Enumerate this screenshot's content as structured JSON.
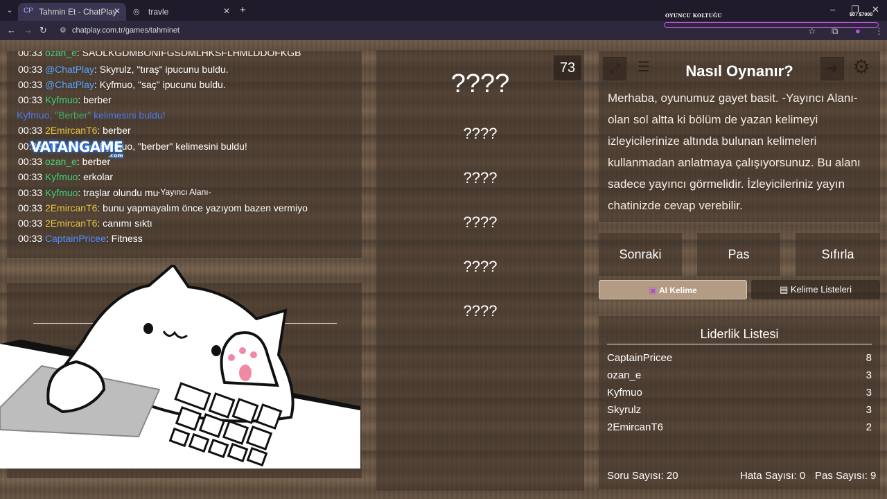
{
  "browser": {
    "tabs": [
      {
        "label": "Tahmin Et - ChatPlay",
        "favicon": "CP"
      },
      {
        "label": "travle"
      }
    ],
    "url": "chatplay.com.tr/games/tahminet"
  },
  "overlay": {
    "title": "OYUNCU KOLTUĞU",
    "money": "$0 / $7000",
    "accent": "#c050e0"
  },
  "chat": {
    "lines": [
      {
        "time": "00:33",
        "user": "ozan_e",
        "msg": ": SAOLKGDMBONIFGSDMLHKSFLHMLDDOFKGB",
        "color": "green"
      },
      {
        "time": "00:33",
        "user": "@ChatPlay",
        "msg": ": Skyrulz, \"tıraş\" ipucunu buldu.",
        "color": "blue"
      },
      {
        "time": "00:33",
        "user": "@ChatPlay",
        "msg": ": Kyfmuo, \"saç\" ipucunu buldu.",
        "color": "blue"
      },
      {
        "time": "00:33",
        "user": "Kyfmuo",
        "msg": ": berber",
        "color": "green"
      },
      {
        "time": "",
        "user": "Kyfmuo, ",
        "msg": " kelimesini buldu!",
        "word": "\"Berber\"",
        "color": "sys"
      },
      {
        "time": "00:33",
        "user": "2EmircanT6",
        "msg": ": berber",
        "color": "yellow"
      },
      {
        "time": "00:33",
        "user": "@ChatPlay",
        "msg": ": Kyfmuo, \"berber\" kelimesini buldu!",
        "color": "blue"
      },
      {
        "time": "00:33",
        "user": "ozan_e",
        "msg": ": berber",
        "color": "green"
      },
      {
        "time": "00:33",
        "user": "Kyfmuo",
        "msg": ": erkolar",
        "color": "green"
      },
      {
        "time": "00:33",
        "user": "Kyfmuo",
        "msg": ": traşlar olundu mu",
        "color": "green"
      },
      {
        "time": "00:33",
        "user": "2EmircanT6",
        "msg": ": bunu yapmayalım önce yazıyom bazen vermiyo",
        "color": "yellow"
      },
      {
        "time": "00:33",
        "user": "2EmircanT6",
        "msg": ": canımı sıktı",
        "color": "yellow"
      },
      {
        "time": "00:33",
        "user": "CaptainPricee",
        "msg": ": Fitness",
        "color": "cpt"
      }
    ]
  },
  "watermark": {
    "text": "VATANGAME",
    "sub": ".com"
  },
  "streamer": {
    "label": "-Yayıncı Alanı-"
  },
  "words": {
    "timer": "73",
    "main": "????",
    "hints": [
      "????",
      "????",
      "????",
      "????",
      "????"
    ]
  },
  "help": {
    "title": "Nasıl Oynanır?",
    "text": "Merhaba, oyunumuz gayet basit. -Yayıncı Alanı- olan sol altta ki bölüm de yazan kelimeyi izleyicilerinize altında bulunan kelimeleri kullanmadan anlatmaya çalışıyorsunuz. Bu alanı sadece yayıncı görmelidir. İzleyicileriniz yayın chatinizde cevap verebilir."
  },
  "actions": {
    "next": "Sonraki",
    "pass": "Pas",
    "reset": "Sıfırla",
    "ai_word": "AI Kelime",
    "word_lists": "Kelime Listeleri"
  },
  "leaderboard": {
    "title": "Liderlik Listesi",
    "rows": [
      {
        "name": "CaptainPricee",
        "score": "8"
      },
      {
        "name": "ozan_e",
        "score": "3"
      },
      {
        "name": "Kyfmuo",
        "score": "3"
      },
      {
        "name": "Skyrulz",
        "score": "3"
      },
      {
        "name": "2EmircanT6",
        "score": "2"
      }
    ],
    "question_count": "Soru Sayısı: 20",
    "error_count": "Hata Sayısı: 0",
    "pass_count": "Pas Sayısı: 9"
  }
}
